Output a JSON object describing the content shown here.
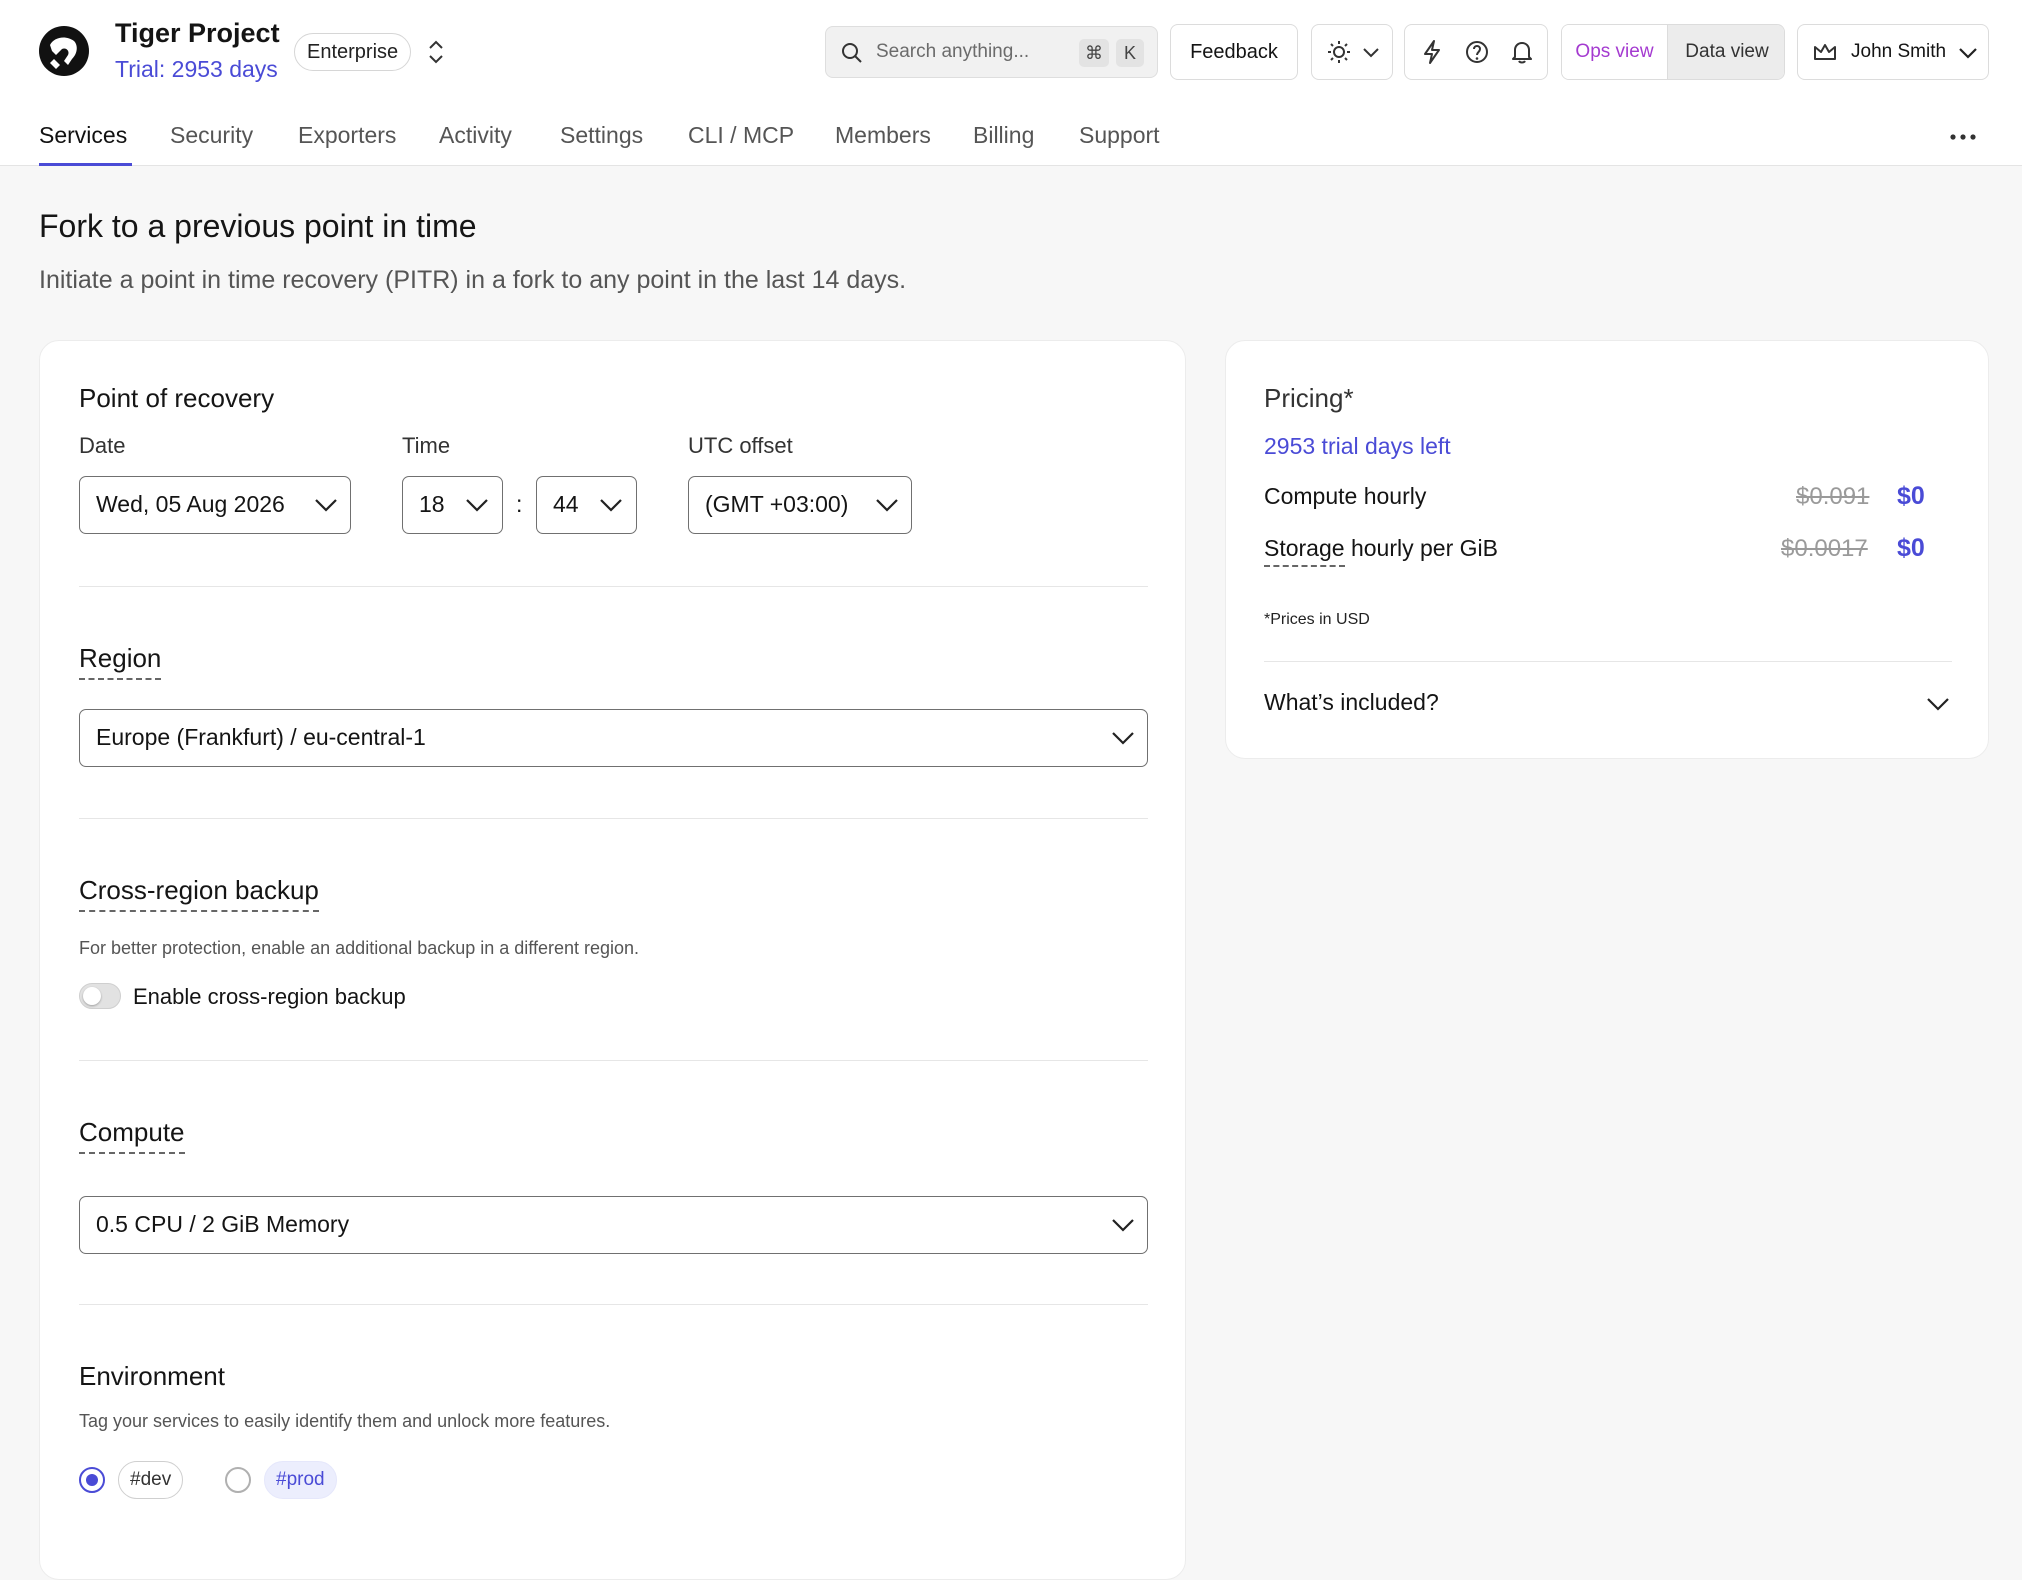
{
  "header": {
    "project_name": "Tiger Project",
    "trial_text": "Trial: 2953 days",
    "plan_badge": "Enterprise",
    "search_placeholder": "Search anything...",
    "search_shortcut_1": "⌘",
    "search_shortcut_2": "K",
    "feedback_label": "Feedback",
    "ops_view_label": "Ops view",
    "data_view_label": "Data view",
    "user_name": "John Smith"
  },
  "tabs": [
    "Services",
    "Security",
    "Exporters",
    "Activity",
    "Settings",
    "CLI / MCP",
    "Members",
    "Billing",
    "Support"
  ],
  "page": {
    "title": "Fork to a previous point in time",
    "subtitle": "Initiate a point in time recovery (PITR) in a fork to any point in the last 14 days."
  },
  "recovery": {
    "title": "Point of recovery",
    "date_label": "Date",
    "date_value": "Wed, 05 Aug 2026",
    "time_label": "Time",
    "hour_value": "18",
    "time_separator": ":",
    "minute_value": "44",
    "utc_label": "UTC offset",
    "utc_value": "(GMT +03:00)"
  },
  "region": {
    "title": "Region",
    "value": "Europe (Frankfurt) / eu-central-1"
  },
  "cross_region": {
    "title": "Cross-region backup",
    "helper": "For better protection, enable an additional backup in a different region.",
    "toggle_label": "Enable cross-region backup",
    "enabled": false
  },
  "compute": {
    "title": "Compute",
    "value": "0.5 CPU / 2 GiB Memory"
  },
  "environment": {
    "title": "Environment",
    "helper": "Tag your services to easily identify them and unlock more features.",
    "options": [
      "#dev",
      "#prod"
    ],
    "selected": "#dev"
  },
  "pricing": {
    "title": "Pricing*",
    "trial_left": "2953 trial days left",
    "compute_label": "Compute hourly",
    "compute_old": "$0.091",
    "compute_new": "$0",
    "storage_label_a": "Storage",
    "storage_label_b": " hourly per GiB",
    "storage_old": "$0.0017",
    "storage_new": "$0",
    "note": "*Prices in USD",
    "included_label": "What’s included?"
  },
  "colors": {
    "accent": "#4a4bd6",
    "ops_view": "#a43ad0",
    "background": "#f7f7f7"
  }
}
